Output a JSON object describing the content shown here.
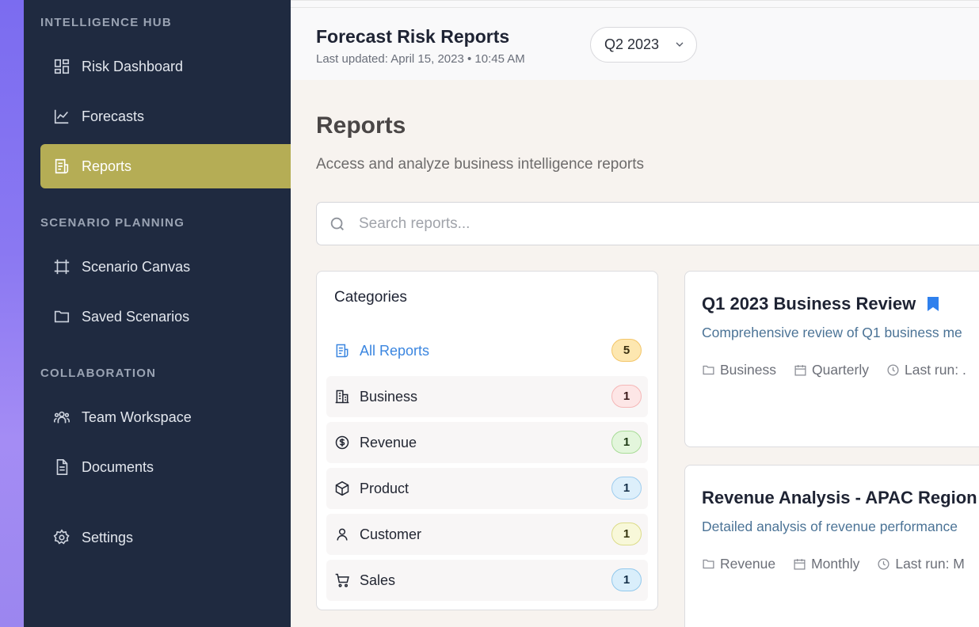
{
  "sidebar": {
    "sections": [
      {
        "title": "INTELLIGENCE HUB"
      },
      {
        "title": "SCENARIO PLANNING"
      },
      {
        "title": "COLLABORATION"
      }
    ],
    "items": [
      {
        "label": "Risk Dashboard",
        "icon": "dashboard-icon"
      },
      {
        "label": "Forecasts",
        "icon": "line-chart-icon"
      },
      {
        "label": "Reports",
        "icon": "report-icon",
        "active": true
      },
      {
        "label": "Scenario Canvas",
        "icon": "frame-icon"
      },
      {
        "label": "Saved Scenarios",
        "icon": "folder-icon"
      },
      {
        "label": "Team Workspace",
        "icon": "team-icon"
      },
      {
        "label": "Documents",
        "icon": "document-icon"
      },
      {
        "label": "Settings",
        "icon": "gear-icon"
      }
    ]
  },
  "header": {
    "title": "Forecast Risk Reports",
    "subtitle": "Last updated: April 15, 2023 • 10:45 AM",
    "period": "Q2 2023"
  },
  "main": {
    "title": "Reports",
    "subtitle": "Access and analyze business intelligence reports",
    "search_placeholder": "Search reports..."
  },
  "categories": {
    "title": "Categories",
    "items": [
      {
        "label": "All Reports",
        "count": "5",
        "icon": "report-icon",
        "active": true,
        "badge_bg": "#fde7b0",
        "badge_border": "#f3c66a"
      },
      {
        "label": "Business",
        "count": "1",
        "icon": "building-icon",
        "badge_bg": "#fde6e6",
        "badge_border": "#f5b7b7"
      },
      {
        "label": "Revenue",
        "count": "1",
        "icon": "dollar-icon",
        "badge_bg": "#e3f6dc",
        "badge_border": "#a9dc98"
      },
      {
        "label": "Product",
        "count": "1",
        "icon": "box-icon",
        "badge_bg": "#ddeffb",
        "badge_border": "#9fcdee"
      },
      {
        "label": "Customer",
        "count": "1",
        "icon": "user-icon",
        "badge_bg": "#f8f8d9",
        "badge_border": "#dcdc8a"
      },
      {
        "label": "Sales",
        "count": "1",
        "icon": "cart-icon",
        "badge_bg": "#d9eefb",
        "badge_border": "#93c9ec"
      }
    ]
  },
  "reports": [
    {
      "title": "Q1 2023 Business Review",
      "bookmarked": true,
      "description": "Comprehensive review of Q1 business me",
      "category": "Business",
      "frequency": "Quarterly",
      "last_run": "Last run: ."
    },
    {
      "title": "Revenue Analysis - APAC Region",
      "bookmarked": false,
      "description": "Detailed analysis of revenue performance",
      "category": "Revenue",
      "frequency": "Monthly",
      "last_run": "Last run: M"
    }
  ],
  "colors": {
    "sidebar_bg": "#1f2a40",
    "active_nav": "#b5ad55",
    "accent_blue": "#3b86e0"
  }
}
